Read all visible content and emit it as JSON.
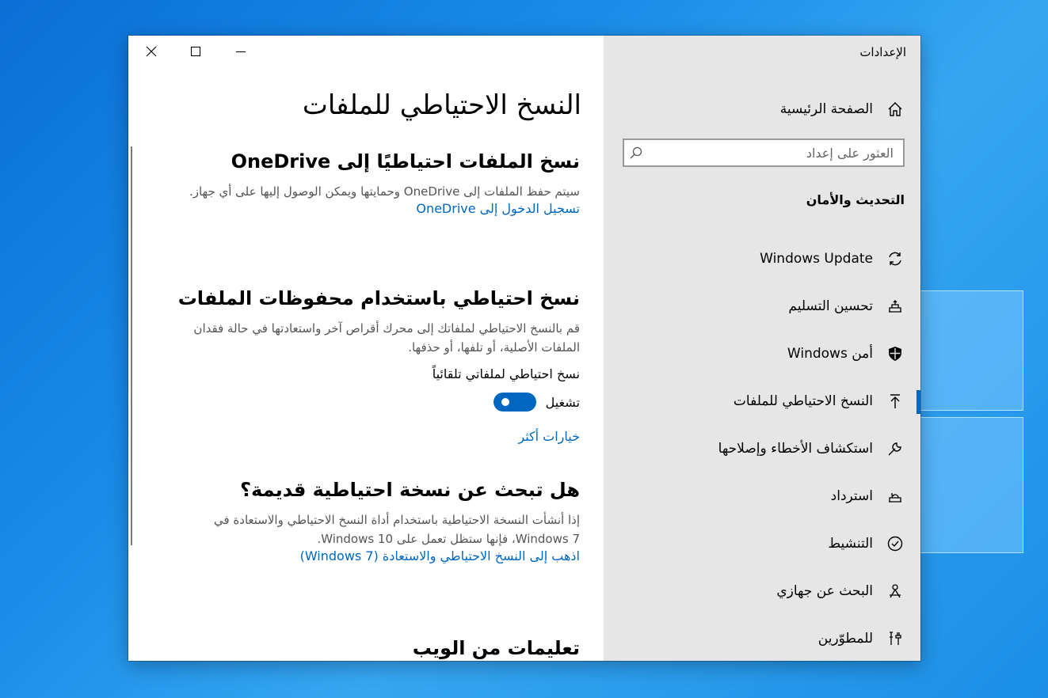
{
  "window": {
    "app_title": "الإعدادات"
  },
  "nav": {
    "home_label": "الصفحة الرئيسية",
    "search_placeholder": "العثور على إعداد",
    "section_heading": "التحديث والأمان",
    "items": [
      {
        "label": "Windows Update",
        "icon": "refresh-icon"
      },
      {
        "label": "تحسين التسليم",
        "icon": "delivery-icon"
      },
      {
        "label": "أمن Windows",
        "icon": "shield-icon"
      },
      {
        "label": "النسخ الاحتياطي للملفات",
        "icon": "upload-arrow-icon",
        "selected": true
      },
      {
        "label": "استكشاف الأخطاء وإصلاحها",
        "icon": "wrench-icon"
      },
      {
        "label": "استرداد",
        "icon": "recovery-icon"
      },
      {
        "label": "التنشيط",
        "icon": "check-circle-icon"
      },
      {
        "label": "البحث عن جهازي",
        "icon": "find-device-icon"
      },
      {
        "label": "للمطوّرين",
        "icon": "developer-tools-icon"
      }
    ]
  },
  "content": {
    "page_title": "النسخ الاحتياطي للملفات",
    "onedrive": {
      "heading": "نسخ الملفات احتياطيًا إلى OneDrive",
      "description": "سيتم حفظ الملفات إلى OneDrive وحمايتها ويمكن الوصول إليها على أي جهاز.",
      "link": "تسجيل الدخول إلى OneDrive"
    },
    "file_history": {
      "heading": "نسخ احتياطي باستخدام محفوظات الملفات",
      "description": "قم بالنسخ الاحتياطي لملفاتك إلى محرك أقراص آخر واستعادتها في حالة فقدان الملفات الأصلية، أو تلفها، أو حذفها.",
      "auto_backup_label": "نسخ احتياطي لملفاتي تلقائياً",
      "toggle_state": "تشغيل",
      "toggle_on": true,
      "more_options": "خيارات أكثر"
    },
    "older_backup": {
      "heading": "هل تبحث عن نسخة احتياطية قديمة؟",
      "description": "إذا أنشأت النسخة الاحتياطية باستخدام أداة النسخ الاحتياطي والاستعادة في Windows 7، فإنها ستظل تعمل على Windows 10.",
      "link": "اذهب إلى النسخ الاحتياطي والاستعادة (Windows 7)"
    },
    "web_help": {
      "heading": "تعليمات من الويب"
    }
  }
}
